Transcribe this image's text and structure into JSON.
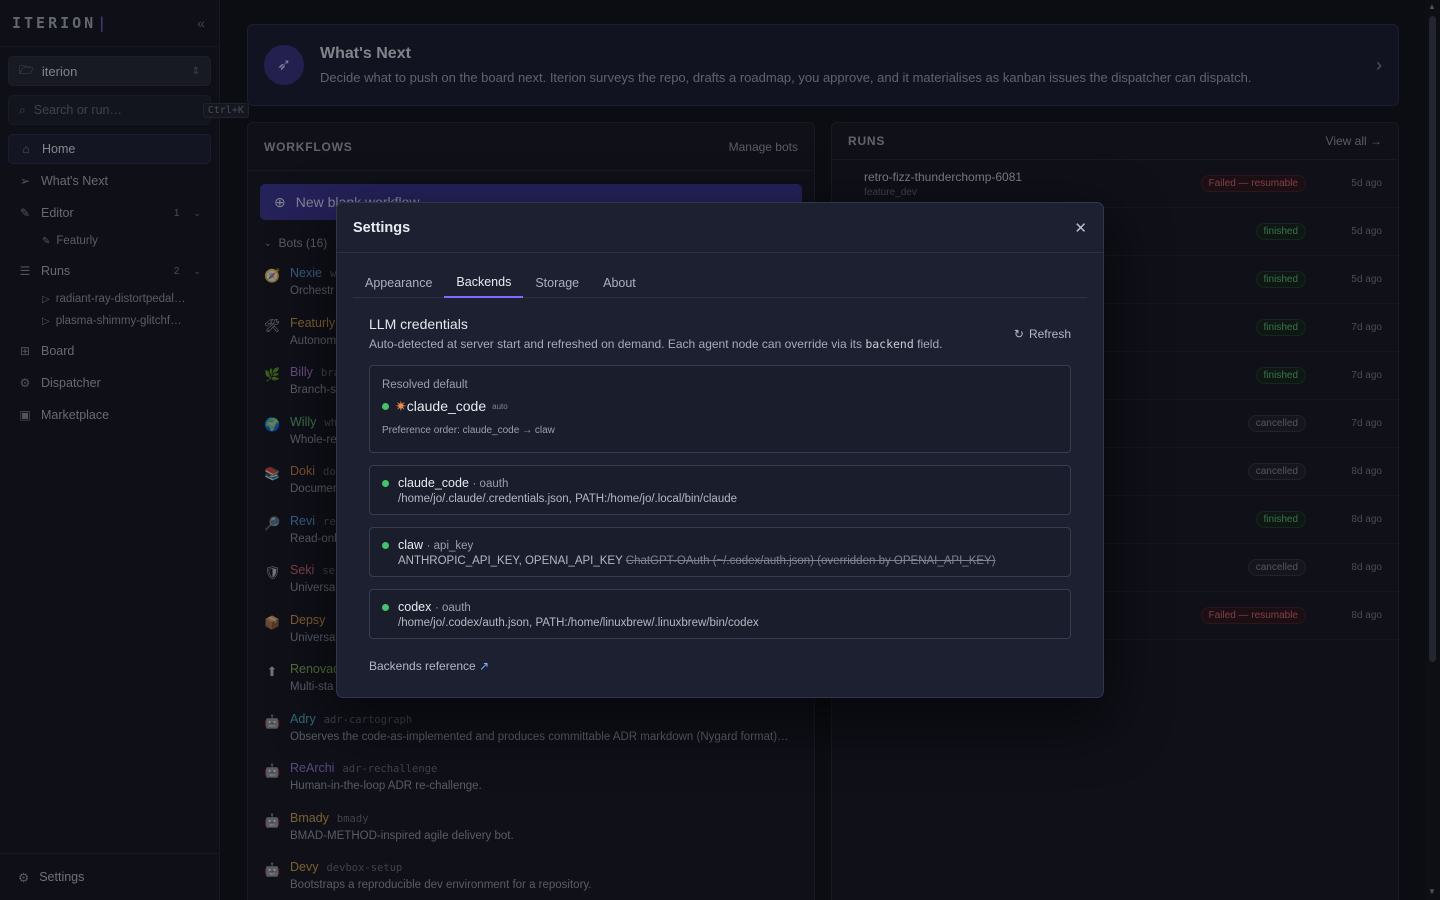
{
  "sidebar": {
    "brand": "ITERION",
    "workspace": "iterion",
    "search_placeholder": "Search or run…",
    "search_shortcut": "Ctrl+K",
    "items": [
      {
        "label": "Home",
        "icon": "home-icon",
        "glyph": "⌂"
      },
      {
        "label": "What's Next",
        "icon": "send-icon",
        "glyph": "➢"
      },
      {
        "label": "Editor",
        "icon": "edit-icon",
        "glyph": "✎",
        "count": "1"
      },
      {
        "label": "Featurly",
        "icon": "edit-icon",
        "glyph": "✎"
      },
      {
        "label": "Runs",
        "icon": "list-icon",
        "glyph": "☰",
        "count": "2"
      },
      {
        "label": "radiant-ray-distortpedal…",
        "icon": "play-icon",
        "glyph": "▷"
      },
      {
        "label": "plasma-shimmy-glitchf…",
        "icon": "play-icon",
        "glyph": "▷"
      },
      {
        "label": "Board",
        "icon": "board-icon",
        "glyph": "⊞"
      },
      {
        "label": "Dispatcher",
        "icon": "dispatcher-icon",
        "glyph": "⚙"
      },
      {
        "label": "Marketplace",
        "icon": "marketplace-icon",
        "glyph": "▣"
      }
    ],
    "settings_label": "Settings"
  },
  "banner": {
    "title": "What's Next",
    "description": "Decide what to push on the board next. Iterion surveys the repo, drafts a roadmap, you approve, and it materialises as kanban issues the dispatcher can dispatch."
  },
  "workflows": {
    "title": "WORKFLOWS",
    "manage_label": "Manage bots",
    "new_label": "New blank workflow",
    "bots_label": "Bots (16)",
    "bots": [
      {
        "name": "Nexie",
        "slug": "w",
        "desc": "Orchestr",
        "color": "#5aa4e6",
        "glyph": "🧭"
      },
      {
        "name": "Featurly",
        "slug": "",
        "desc": "Autonom",
        "color": "#d9a84a",
        "glyph": "🛠"
      },
      {
        "name": "Billy",
        "slug": "bra",
        "desc": "Branch-s",
        "color": "#b483e0",
        "glyph": "🌿"
      },
      {
        "name": "Willy",
        "slug": "wh",
        "desc": "Whole-re",
        "color": "#5fc97b",
        "glyph": "🌍"
      },
      {
        "name": "Doki",
        "slug": "do",
        "desc": "Documen",
        "color": "#e28a4c",
        "glyph": "📚"
      },
      {
        "name": "Revi",
        "slug": "re",
        "desc": "Read-onl",
        "color": "#5aa4e6",
        "glyph": "🔎"
      },
      {
        "name": "Seki",
        "slug": "se",
        "desc": "Universa",
        "color": "#e26d78",
        "glyph": "🛡"
      },
      {
        "name": "Depsy",
        "slug": "",
        "desc": "Universa",
        "color": "#e8a54c",
        "glyph": "📦"
      },
      {
        "name": "Renovac",
        "slug": "",
        "desc": "Multi-sta",
        "color": "#8cc35a",
        "glyph": "⬆"
      },
      {
        "name": "Adry",
        "slug": "adr-cartograph",
        "desc": "Observes the code-as-implemented and produces committable ADR markdown (Nygard format) in …",
        "color": "#4fb8c9",
        "glyph": "🤖"
      },
      {
        "name": "ReArchi",
        "slug": "adr-rechallenge",
        "desc": "Human-in-the-loop ADR re-challenge.",
        "color": "#9b7be6",
        "glyph": "🤖"
      },
      {
        "name": "Bmady",
        "slug": "bmady",
        "desc": "BMAD-METHOD-inspired agile delivery bot.",
        "color": "#d9a84a",
        "glyph": "🤖"
      },
      {
        "name": "Devy",
        "slug": "devbox-setup",
        "desc": "Bootstraps a reproducible dev environment for a repository.",
        "color": "#d9a84a",
        "glyph": "🤖"
      }
    ]
  },
  "runs": {
    "title": "RUNS",
    "view_all": "View all →",
    "rows": [
      {
        "name": "retro-fizz-thunderchomp-6081",
        "kind": "feature_dev",
        "status": "Failed — resumable",
        "status_class": "failed",
        "age": "5d ago"
      },
      {
        "name": "",
        "kind": "",
        "status": "finished",
        "status_class": "finished",
        "age": "5d ago"
      },
      {
        "name": "",
        "kind": "",
        "status": "finished",
        "status_class": "finished",
        "age": "5d ago"
      },
      {
        "name": "",
        "kind": "",
        "status": "finished",
        "status_class": "finished",
        "age": "7d ago"
      },
      {
        "name": "",
        "kind": "",
        "status": "finished",
        "status_class": "finished",
        "age": "7d ago"
      },
      {
        "name": "",
        "kind": "",
        "status": "cancelled",
        "status_class": "cancelled",
        "age": "7d ago"
      },
      {
        "name": "",
        "kind": "",
        "status": "cancelled",
        "status_class": "cancelled",
        "age": "8d ago"
      },
      {
        "name": "",
        "kind": "",
        "status": "finished",
        "status_class": "finished",
        "age": "8d ago"
      },
      {
        "name": "",
        "kind": "",
        "status": "cancelled",
        "status_class": "cancelled",
        "age": "8d ago"
      },
      {
        "name": "",
        "kind": "",
        "status": "Failed — resumable",
        "status_class": "failed",
        "age": "8d ago"
      }
    ]
  },
  "modal": {
    "title": "Settings",
    "tabs": [
      "Appearance",
      "Backends",
      "Storage",
      "About"
    ],
    "active_tab": "Backends",
    "section_title": "LLM credentials",
    "section_desc_before": "Auto-detected at server start and refreshed on demand. Each agent node can override via its",
    "section_desc_code": "backend",
    "section_desc_after": "field.",
    "refresh_label": "Refresh",
    "resolved_label": "Resolved default",
    "resolved_name": "claude_code",
    "resolved_tag": "auto",
    "preference": "Preference order: claude_code → claw",
    "credentials": [
      {
        "name": "claude_code",
        "kind": "· oauth",
        "detail": "/home/jo/.claude/.credentials.json, PATH:/home/jo/.local/bin/claude",
        "strike": ""
      },
      {
        "name": "claw",
        "kind": "· api_key",
        "detail": "ANTHROPIC_API_KEY, OPENAI_API_KEY",
        "strike": "ChatGPT-OAuth (~/.codex/auth.json) (overridden by OPENAI_API_KEY)"
      },
      {
        "name": "codex",
        "kind": "· oauth",
        "detail": "/home/jo/.codex/auth.json, PATH:/home/linuxbrew/.linuxbrew/bin/codex",
        "strike": ""
      }
    ],
    "reference_label": "Backends reference",
    "reference_icon": "↗"
  }
}
